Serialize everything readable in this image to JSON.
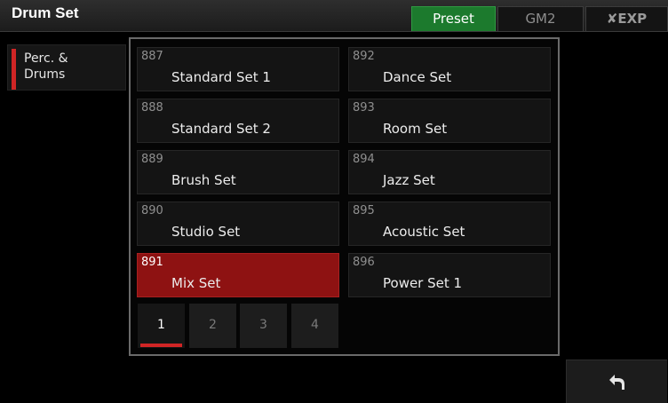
{
  "header": {
    "title": "Drum Set",
    "tabs": [
      {
        "label": "Preset",
        "active": true
      },
      {
        "label": "GM2",
        "active": false
      },
      {
        "label": "EXP",
        "active": false,
        "icon": "x-logo-icon"
      }
    ]
  },
  "categories": [
    {
      "label": "Perc. & Drums",
      "selected": true
    }
  ],
  "voices": [
    {
      "number": "887",
      "name": "Standard Set 1"
    },
    {
      "number": "888",
      "name": "Standard Set 2"
    },
    {
      "number": "889",
      "name": "Brush Set"
    },
    {
      "number": "890",
      "name": "Studio Set"
    },
    {
      "number": "891",
      "name": "Mix Set",
      "selected": true
    },
    {
      "number": "892",
      "name": "Dance Set"
    },
    {
      "number": "893",
      "name": "Room Set"
    },
    {
      "number": "894",
      "name": "Jazz Set"
    },
    {
      "number": "895",
      "name": "Acoustic Set"
    },
    {
      "number": "896",
      "name": "Power Set 1"
    }
  ],
  "pages": [
    "1",
    "2",
    "3",
    "4"
  ],
  "current_page": "1",
  "footer": {
    "back_icon": "return-arrow-icon"
  },
  "colors": {
    "accent_red": "#d02525",
    "selected_voice": "#8e1212",
    "active_tab": "#1c7a2d"
  }
}
